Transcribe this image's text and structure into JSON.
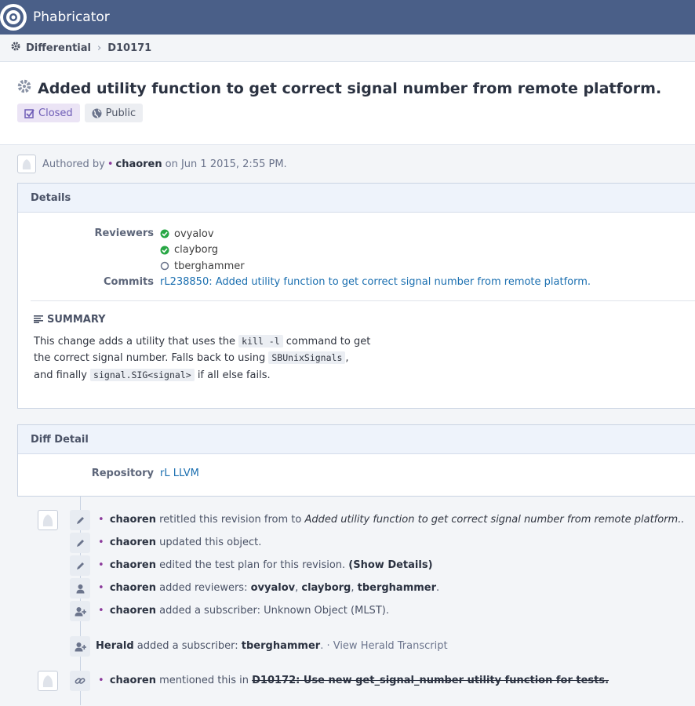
{
  "app": {
    "name": "Phabricator"
  },
  "breadcrumb": {
    "app": "Differential",
    "item": "D10171"
  },
  "revision": {
    "title": "Added utility function to get correct signal number from remote platform.",
    "status": "Closed",
    "visibility": "Public"
  },
  "authored": {
    "prefix": "Authored by",
    "user": "chaoren",
    "suffix": "on Jun 1 2015, 2:55 PM."
  },
  "details": {
    "heading": "Details",
    "reviewers_label": "Reviewers",
    "reviewers": [
      {
        "name": "ovyalov",
        "status": "accepted"
      },
      {
        "name": "clayborg",
        "status": "accepted"
      },
      {
        "name": "tberghammer",
        "status": "pending"
      }
    ],
    "commits_label": "Commits",
    "commit_link": "rL238850: Added utility function to get correct signal number from remote platform.",
    "summary_heading": "SUMMARY",
    "summary": {
      "t1": "This change adds a utility that uses the",
      "c1": "kill -l",
      "t2": "command to get the correct signal number. Falls back to using",
      "c2": "SBUnixSignals",
      "t3": ", and finally",
      "c3": "signal.SIG<signal>",
      "t4": "if all else fails."
    }
  },
  "diff_detail": {
    "heading": "Diff Detail",
    "repository_label": "Repository",
    "repository": "rL LLVM"
  },
  "timeline": {
    "e1": {
      "user": "chaoren",
      "text": "retitled this revision from to",
      "title": "Added utility function to get correct signal number from remote platform.."
    },
    "e2": {
      "user": "chaoren",
      "text": "updated this object."
    },
    "e3": {
      "user": "chaoren",
      "text": "edited the test plan for this revision.",
      "link": "(Show Details)"
    },
    "e4": {
      "user": "chaoren",
      "text": "added reviewers:",
      "r1": "ovyalov",
      "r2": "clayborg",
      "r3": "tberghammer"
    },
    "e5": {
      "user": "chaoren",
      "text": "added a subscriber: Unknown Object (MLST)."
    },
    "e6": {
      "user": "Herald",
      "text": "added a subscriber:",
      "target": "tberghammer",
      "after": ". · View Herald Transcript"
    },
    "e7": {
      "user": "chaoren",
      "text": "mentioned this in",
      "ref": "D10172: Use new get_signal_number utility function for tests."
    }
  },
  "colors": {
    "topbar": "#4a5f88",
    "accepted": "#28a745",
    "closed_tag": "#6e5cb6",
    "link": "#1b6fb0"
  }
}
